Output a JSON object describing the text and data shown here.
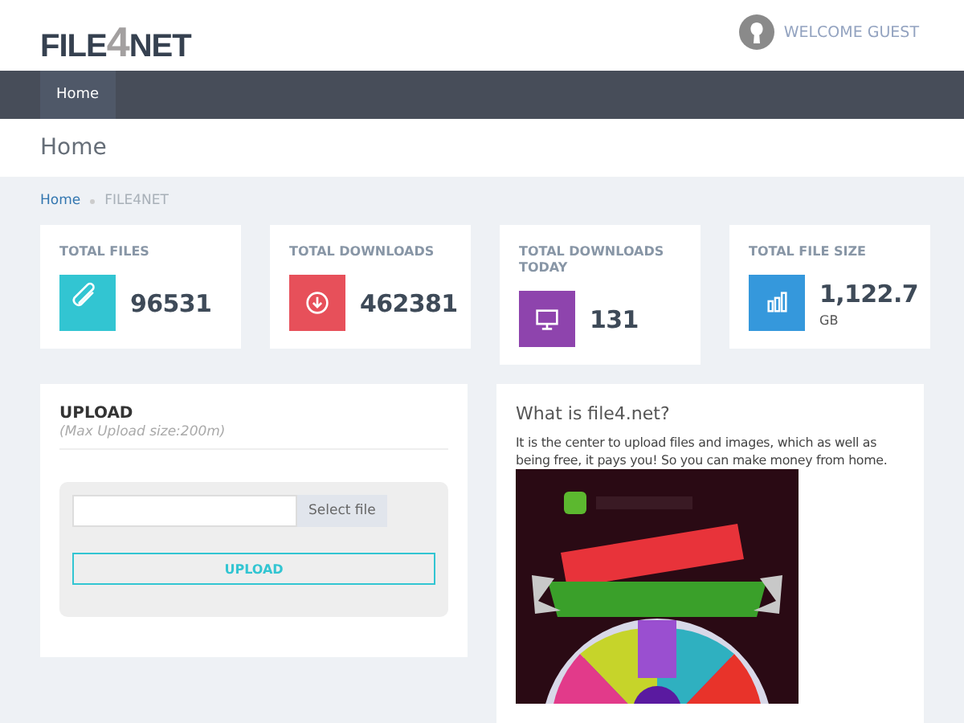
{
  "header": {
    "logo": [
      "FILE",
      "4",
      "NET"
    ],
    "welcome": "WELCOME GUEST"
  },
  "nav": {
    "items": [
      {
        "label": "Home",
        "selected": true
      }
    ]
  },
  "page_title": "Home",
  "breadcrumb": [
    "Home",
    "FILE4NET"
  ],
  "stats": [
    {
      "label": "TOTAL FILES",
      "value": "96531",
      "color": "#32c5d2"
    },
    {
      "label": "TOTAL DOWNLOADS",
      "value": "462381",
      "color": "#e7505a"
    },
    {
      "label": "TOTAL DOWNLOADS TODAY",
      "value": "131",
      "color": "#8e44ad"
    },
    {
      "label": "TOTAL FILE SIZE",
      "value": "1,122.7",
      "unit": "GB",
      "color": "#3598dc"
    }
  ],
  "upload": {
    "title": "UPLOAD",
    "subtitle": "(Max Upload size:200m)",
    "select_button": "Select file",
    "upload_button": "UPLOAD"
  },
  "info": {
    "title": "What is file4.net?",
    "text": "It is the center to upload files and images, which as well as being free, it pays you! So you can make money from home."
  }
}
